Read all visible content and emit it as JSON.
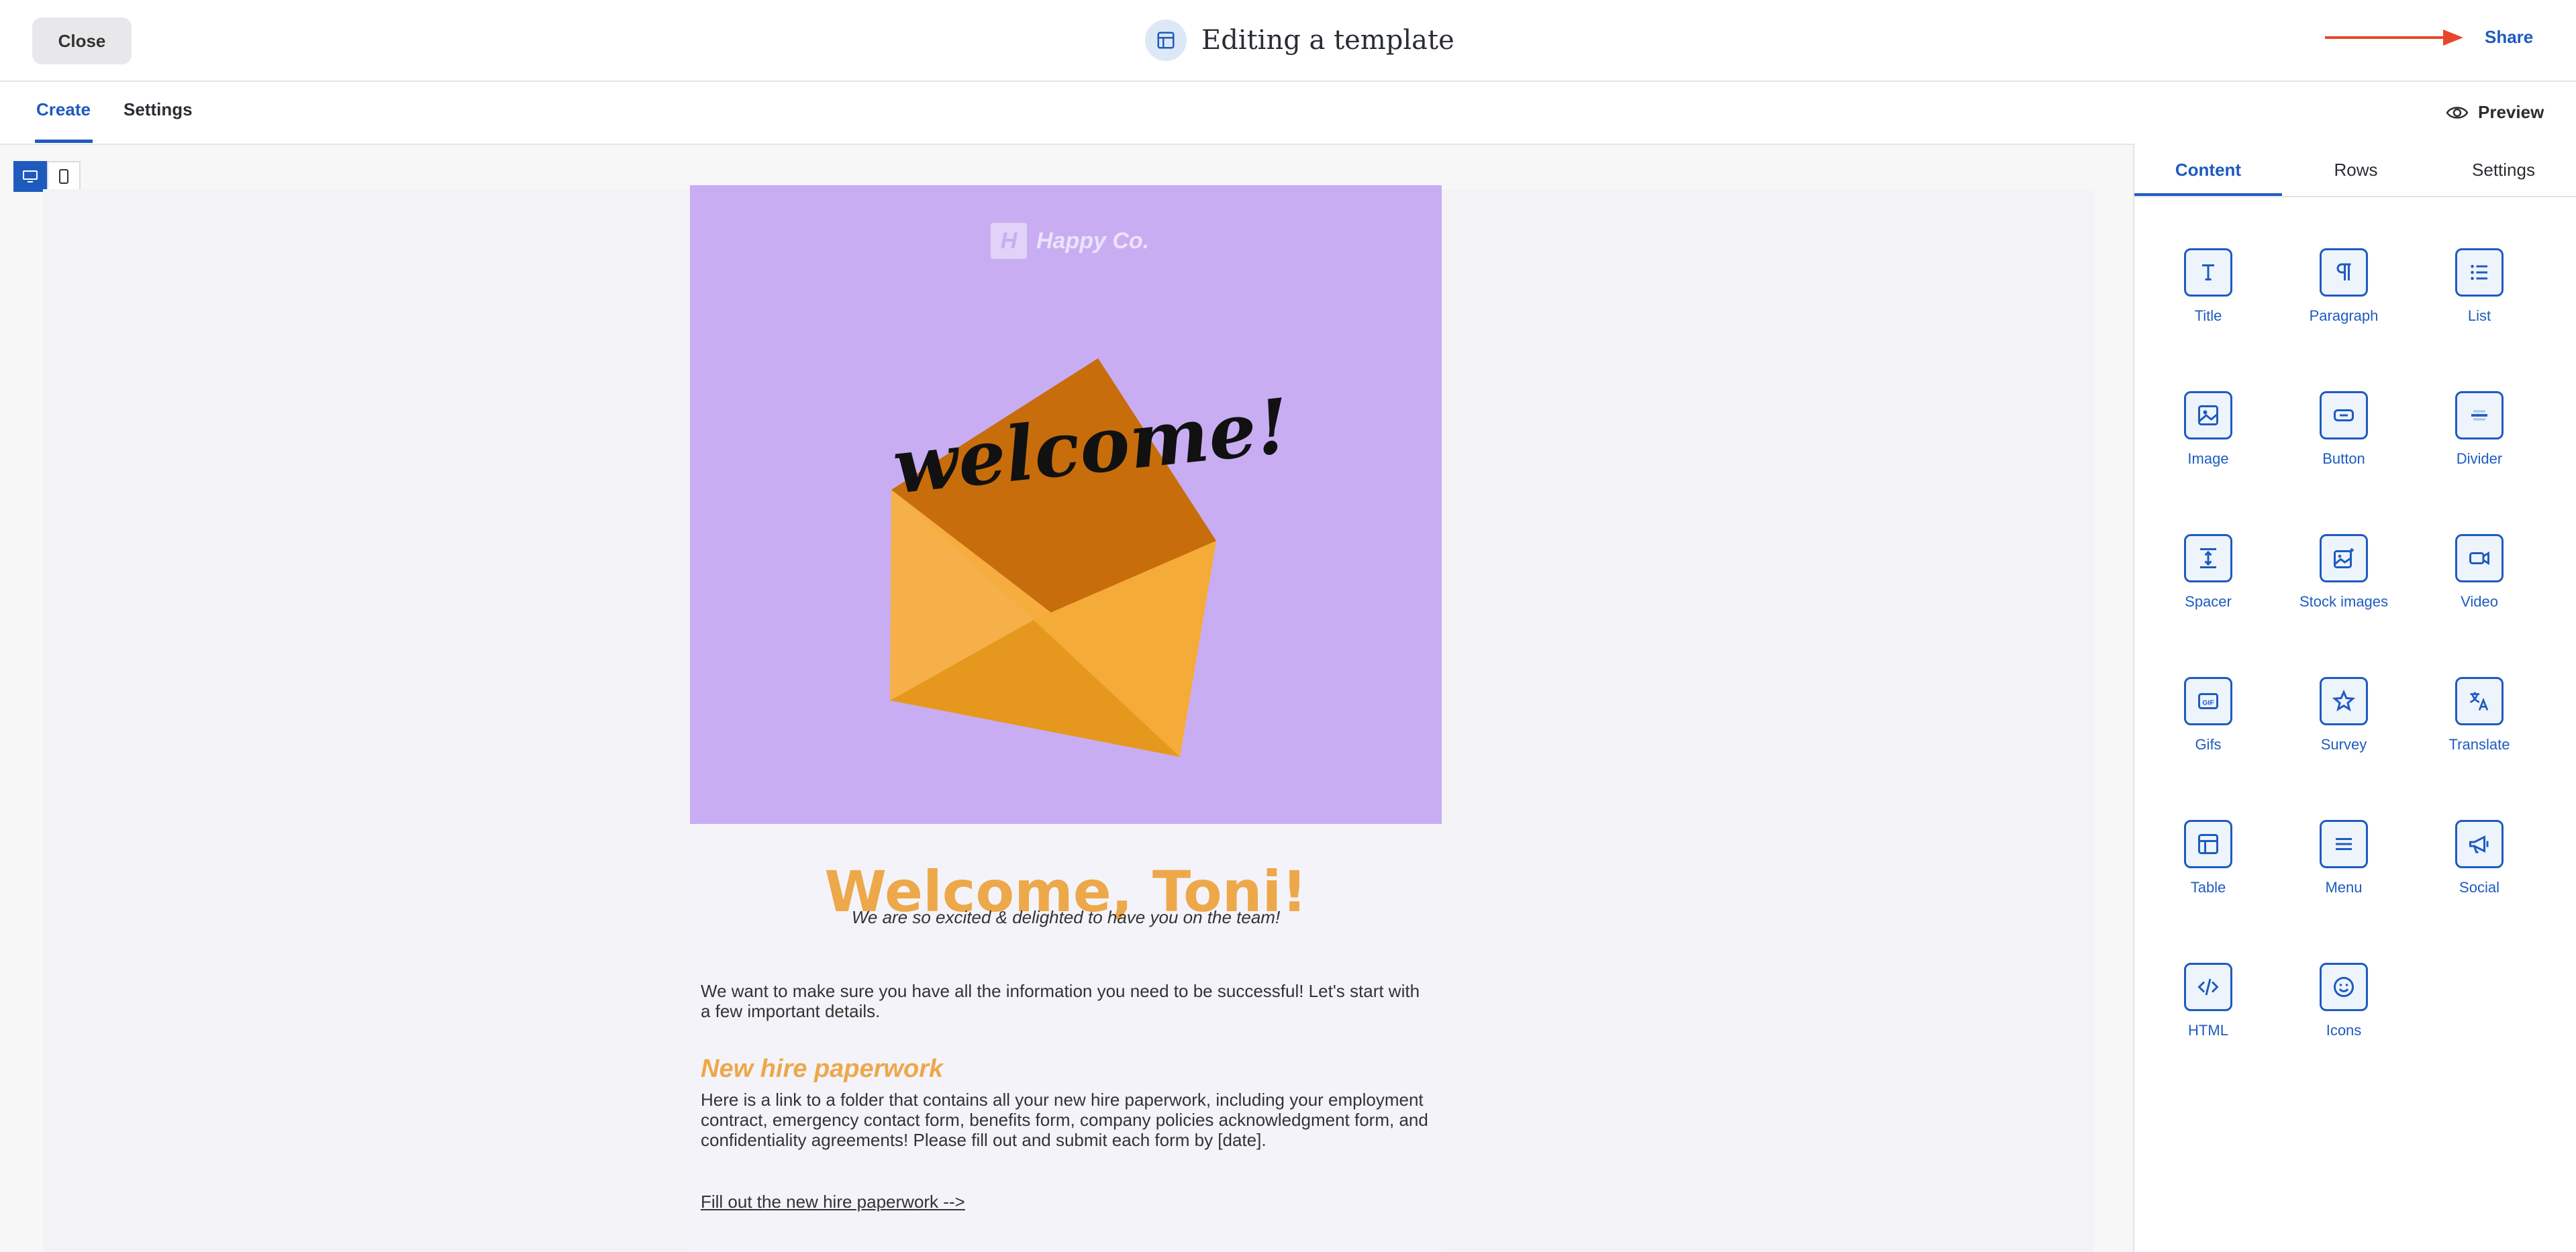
{
  "header": {
    "close_label": "Close",
    "title": "Editing a template",
    "share_label": "Share",
    "arrow_color": "#e8462c"
  },
  "tabs": {
    "create": "Create",
    "settings": "Settings",
    "preview": "Preview"
  },
  "email": {
    "logo_text": "Happy Co.",
    "hero_text": "welcome!",
    "heading": "Welcome, Toni!",
    "subheading": "We are so excited & delighted to have you on the team!",
    "intro": "We want to make sure you have all the information you need to be successful! Let's start with a few important details.",
    "section_title": "New hire paperwork",
    "section_body": "Here is a link to a folder that contains all your new hire paperwork, including your employment contract, emergency contact form, benefits form, company policies acknowledgment form, and confidentiality agreements! Please fill out and submit each form by [date].",
    "section_link": "Fill out the new hire paperwork -->"
  },
  "panel": {
    "tabs": [
      "Content",
      "Rows",
      "Settings"
    ],
    "tiles": [
      {
        "label": "Title",
        "icon": "title-icon"
      },
      {
        "label": "Paragraph",
        "icon": "paragraph-icon"
      },
      {
        "label": "List",
        "icon": "list-icon"
      },
      {
        "label": "Image",
        "icon": "image-icon"
      },
      {
        "label": "Button",
        "icon": "button-icon"
      },
      {
        "label": "Divider",
        "icon": "divider-icon"
      },
      {
        "label": "Spacer",
        "icon": "spacer-icon"
      },
      {
        "label": "Stock images",
        "icon": "stock-images-icon"
      },
      {
        "label": "Video",
        "icon": "video-icon"
      },
      {
        "label": "Gifs",
        "icon": "gif-icon"
      },
      {
        "label": "Survey",
        "icon": "star-icon"
      },
      {
        "label": "Translate",
        "icon": "translate-icon"
      },
      {
        "label": "Table",
        "icon": "table-icon"
      },
      {
        "label": "Menu",
        "icon": "menu-icon"
      },
      {
        "label": "Social",
        "icon": "megaphone-icon"
      },
      {
        "label": "HTML",
        "icon": "code-icon"
      },
      {
        "label": "Icons",
        "icon": "smiley-icon"
      }
    ]
  },
  "colors": {
    "accent": "#1e5bbf",
    "hero_bg": "#c8adf3",
    "heading_orange": "#eda84a"
  }
}
